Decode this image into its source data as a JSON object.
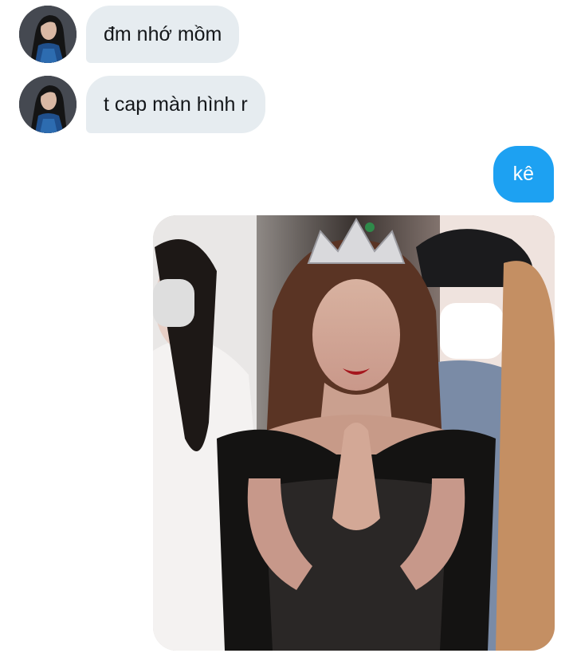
{
  "conversation": {
    "incoming": [
      {
        "sender_avatar": "contact-avatar",
        "text": "đm nhớ mồm"
      },
      {
        "sender_avatar": "contact-avatar",
        "text": "t cap màn hình r"
      }
    ],
    "outgoing": [
      {
        "type": "text",
        "text": "kê"
      },
      {
        "type": "image",
        "description_icon": "photo-attachment"
      }
    ]
  },
  "colors": {
    "incoming_bubble": "#e6ecf0",
    "incoming_text": "#14171a",
    "outgoing_bubble": "#1da1f2",
    "outgoing_text": "#ffffff"
  }
}
